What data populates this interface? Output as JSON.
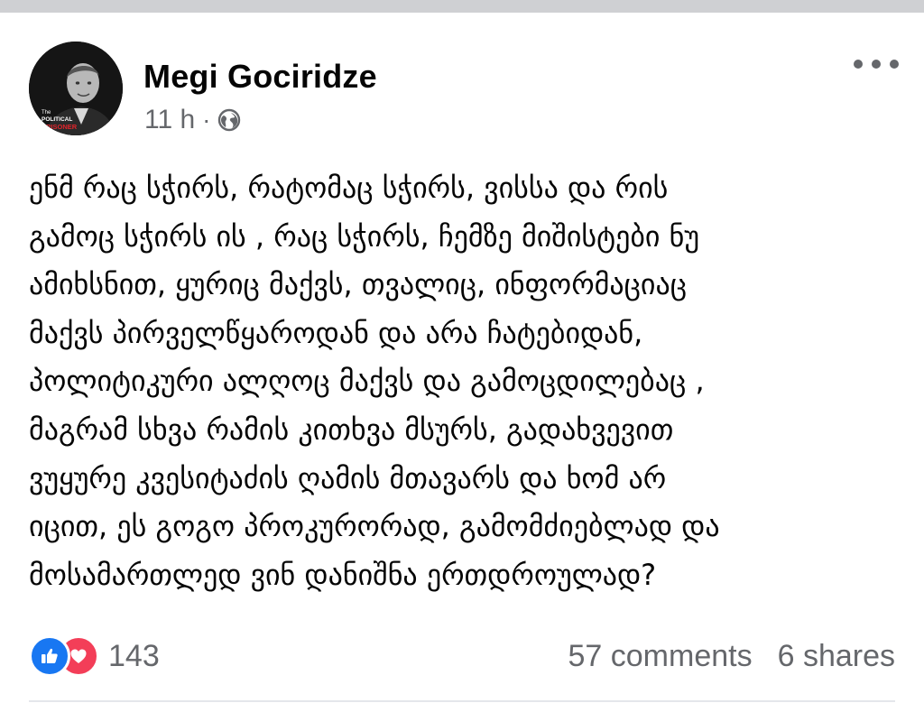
{
  "post": {
    "author_name": "Megi Gociridze",
    "timestamp": "11 h",
    "separator": "·",
    "audience_icon": "globe-icon",
    "more_icon": "more-options-icon",
    "avatar_caption_1": "The",
    "avatar_caption_2": "POLITICAL",
    "avatar_caption_3": "PRISONER",
    "body": "ენმ რაც სჭირს, რატომაც სჭირს, ვისსა და რის\nგამოც სჭირს ის , რაც სჭირს, ჩემზე მიშისტები ნუ\nამიხსნით, ყურიც მაქვს, თვალიც, ინფორმაციაც\nმაქვს პირველწყაროდან და არა ჩატებიდან,\nპოლიტიკური ალღოც მაქვს და გამოცდილებაც ,\nმაგრამ   სხვა რამის კითხვა მსურს,  გადახვევით\nვუყურე კვესიტაძის ღამის მთავარს და ხომ არ\nიცით,  ეს გოგო პროკურორად, გამომძიებლად და\nმოსამართლედ ვინ დანიშნა ერთდროულად?"
  },
  "engagement": {
    "reaction_icons": [
      "like-icon",
      "love-icon"
    ],
    "reaction_count": "143",
    "comments": "57 comments",
    "shares": "6 shares"
  },
  "colors": {
    "text_primary": "#050505",
    "text_secondary": "#65676b",
    "like_blue": "#1877f2",
    "love_red": "#f33e58"
  }
}
